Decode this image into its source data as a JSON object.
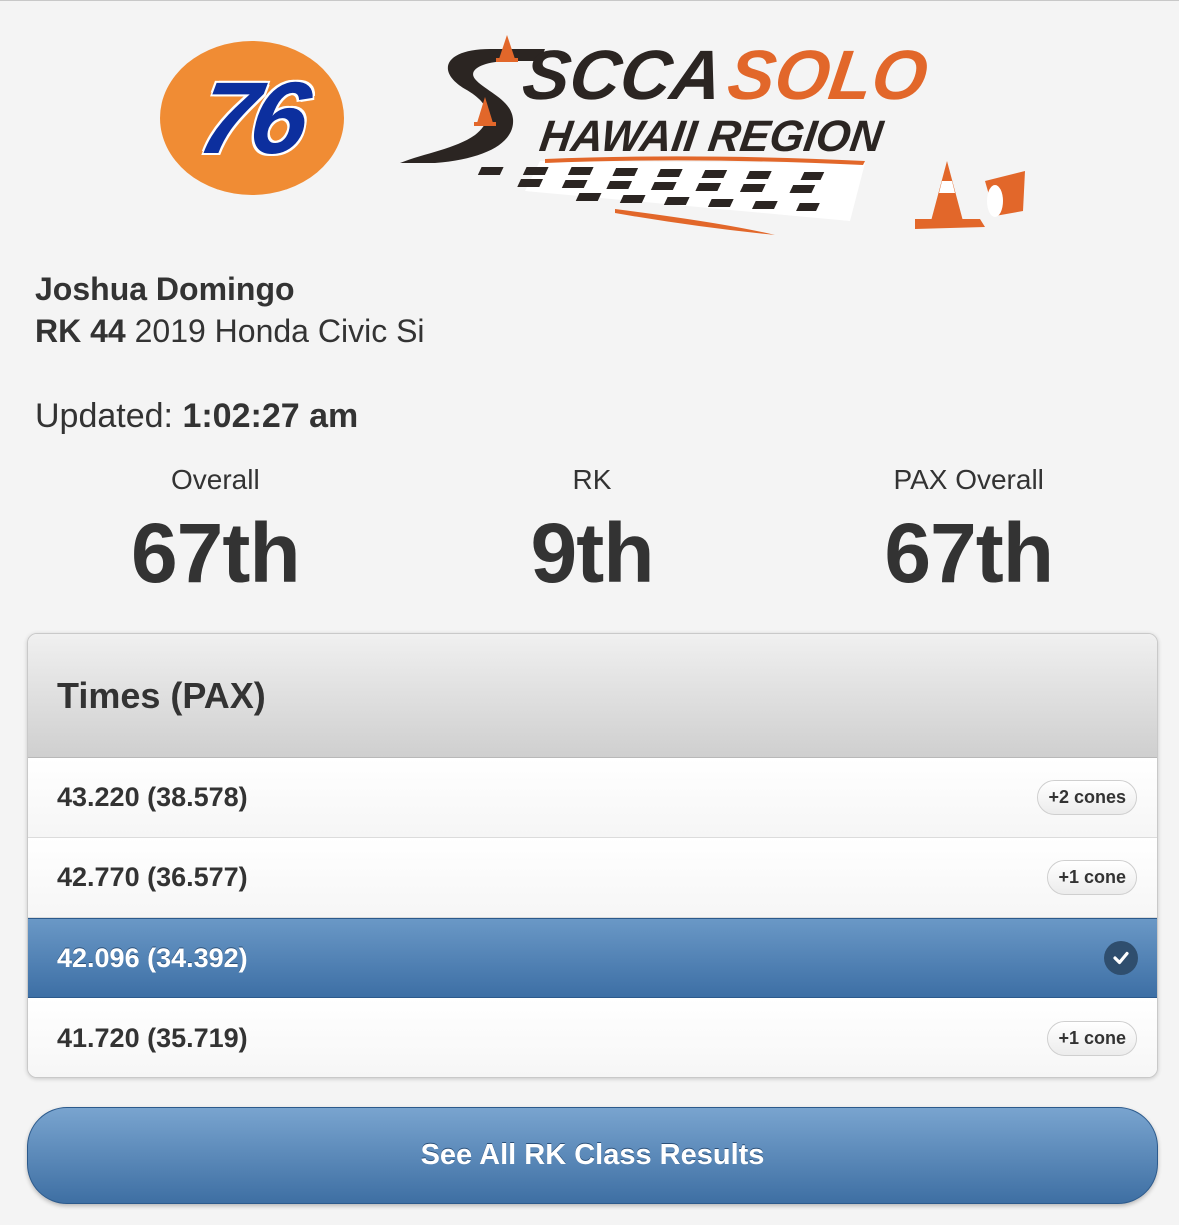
{
  "sponsor_logo": {
    "text": "76",
    "bg_color": "#f08c34",
    "text_color": "#0c2f9e"
  },
  "club_logo": {
    "line1a": "SCCA",
    "line1b": "SOLO",
    "line2": "HAWAII REGION",
    "accent": "#e2672a"
  },
  "driver": {
    "name": "Joshua Domingo",
    "class_number": "RK 44",
    "car": "2019 Honda Civic Si"
  },
  "updated": {
    "label": "Updated:",
    "time": "1:02:27 am"
  },
  "stats": [
    {
      "label": "Overall",
      "value": "67th"
    },
    {
      "label": "RK",
      "value": "9th"
    },
    {
      "label": "PAX Overall",
      "value": "67th"
    }
  ],
  "times": {
    "header": "Times (PAX)",
    "rows": [
      {
        "time": "43.220 (38.578)",
        "badge": "+2 cones",
        "selected": false
      },
      {
        "time": "42.770 (36.577)",
        "badge": "+1 cone",
        "selected": false
      },
      {
        "time": "42.096 (34.392)",
        "badge": "",
        "selected": true
      },
      {
        "time": "41.720 (35.719)",
        "badge": "+1 cone",
        "selected": false
      }
    ]
  },
  "button": {
    "label": "See All RK Class Results"
  },
  "colors": {
    "selected_row": "#4f80b4",
    "button": "#5a8bbe"
  }
}
